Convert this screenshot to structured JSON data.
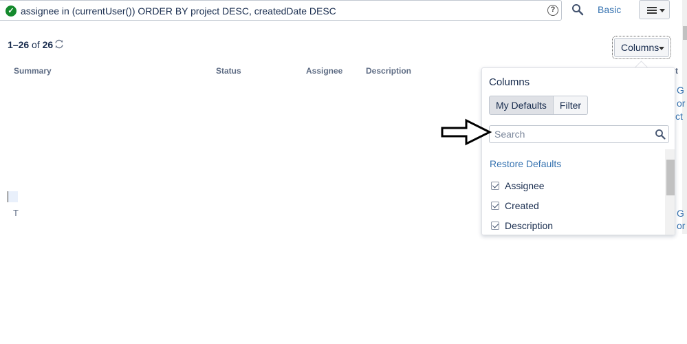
{
  "jql": {
    "query": "assignee in (currentUser()) ORDER BY project DESC, createdDate DESC",
    "status_icon": "check-circle-icon",
    "help_icon": "question-icon",
    "search_icon": "magnifier-icon"
  },
  "header": {
    "basic_link": "Basic",
    "menu_icon": "hamburger-icon"
  },
  "pager": {
    "range": "1–26",
    "of": "of",
    "total": "26",
    "refresh_icon": "refresh-icon"
  },
  "toolbar": {
    "columns_label": "Columns"
  },
  "table": {
    "headers": [
      "Summary",
      "Status",
      "Assignee",
      "Description"
    ],
    "stray_text": "T"
  },
  "right_fragments": [
    "t",
    "G",
    "or",
    "ct",
    "G",
    "or"
  ],
  "columns_popup": {
    "title": "Columns",
    "tabs": [
      "My Defaults",
      "Filter"
    ],
    "search_placeholder": "Search",
    "restore_label": "Restore Defaults",
    "items": [
      {
        "label": "Assignee",
        "checked": true
      },
      {
        "label": "Created",
        "checked": true
      },
      {
        "label": "Description",
        "checked": true
      }
    ]
  },
  "colors": {
    "link": "#3572b0",
    "success": "#14892c",
    "text": "#172b4d",
    "header_text": "#5e6c84"
  }
}
